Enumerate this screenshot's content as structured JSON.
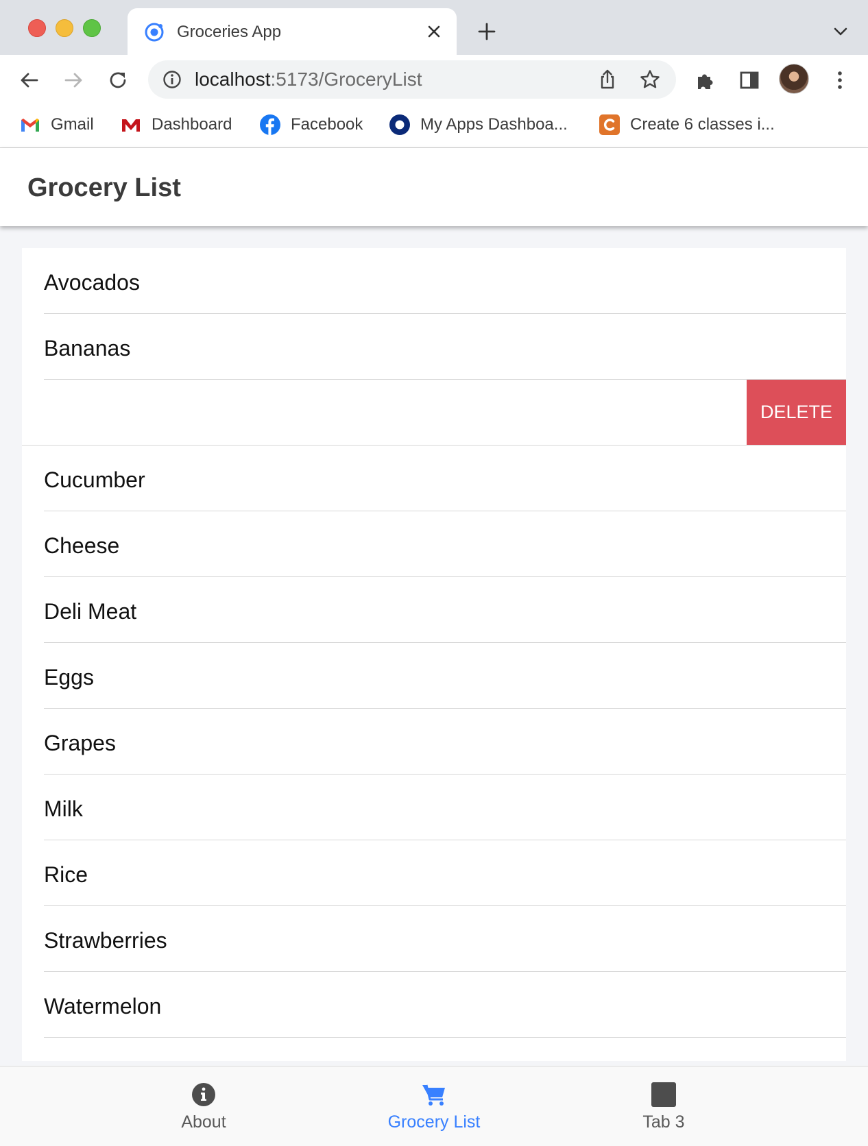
{
  "browser": {
    "tab_title": "Groceries App",
    "url_host": "localhost",
    "url_path": ":5173/GroceryList",
    "bookmarks": [
      {
        "label": "Gmail",
        "icon": "gmail-icon"
      },
      {
        "label": "Dashboard",
        "icon": "dashboard-icon"
      },
      {
        "label": "Facebook",
        "icon": "facebook-icon"
      },
      {
        "label": "My Apps Dashboa...",
        "icon": "myapps-icon"
      },
      {
        "label": "Create 6 classes i...",
        "icon": "create-icon"
      }
    ]
  },
  "header": {
    "title": "Grocery List"
  },
  "list": {
    "items": [
      {
        "label": "Avocados"
      },
      {
        "label": "Bananas"
      },
      {
        "label": "",
        "swiped": true,
        "action": "DELETE"
      },
      {
        "label": "Cucumber"
      },
      {
        "label": "Cheese"
      },
      {
        "label": "Deli Meat"
      },
      {
        "label": "Eggs"
      },
      {
        "label": "Grapes"
      },
      {
        "label": "Milk"
      },
      {
        "label": "Rice"
      },
      {
        "label": "Strawberries"
      },
      {
        "label": "Watermelon"
      }
    ]
  },
  "tabbar": {
    "tabs": [
      {
        "label": "About",
        "icon": "info-icon",
        "active": false
      },
      {
        "label": "Grocery List",
        "icon": "cart-icon",
        "active": true
      },
      {
        "label": "Tab 3",
        "icon": "square-icon",
        "active": false
      }
    ]
  },
  "colors": {
    "accent": "#3880ff",
    "delete": "#dd4f59",
    "background": "#f4f5f8"
  }
}
